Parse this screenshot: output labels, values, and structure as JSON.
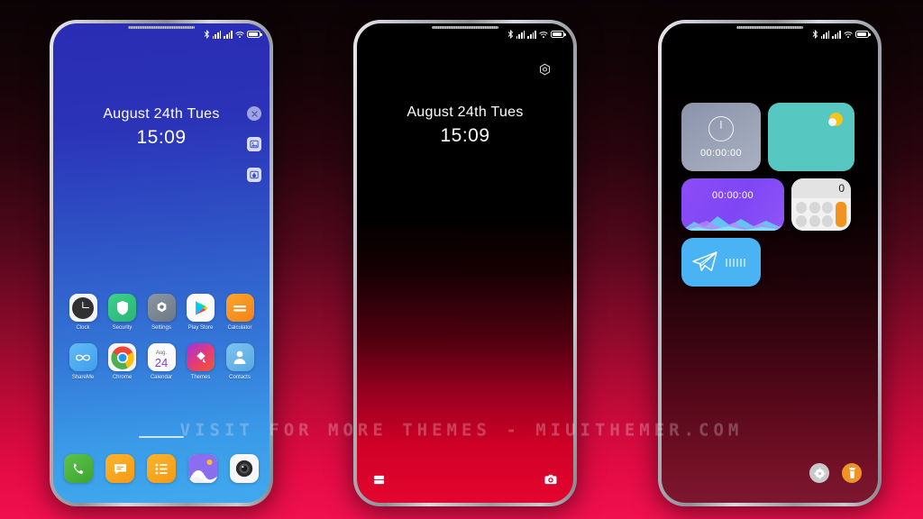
{
  "watermark": "VISIT FOR MORE THEMES - MIUITHEMER.COM",
  "statusbar": {
    "bluetooth_icon": "bluetooth-icon",
    "signal1_icon": "signal-bars-icon",
    "signal2_icon": "signal-bars-icon",
    "wifi_icon": "wifi-icon",
    "battery_icon": "battery-icon"
  },
  "phone1": {
    "name": "home-screen-blue",
    "lock": {
      "date": "August 24th Tues",
      "time": "15:09"
    },
    "side_buttons": [
      {
        "name": "close-button",
        "icon": "close-icon",
        "glyph": "✕"
      },
      {
        "name": "wallpaper-button",
        "icon": "image-icon",
        "glyph": "◰"
      },
      {
        "name": "theme-button",
        "icon": "droplet-icon",
        "glyph": "●"
      }
    ],
    "apps_row1": [
      {
        "label": "Clock",
        "icon": "clock-icon"
      },
      {
        "label": "Security",
        "icon": "shield-icon"
      },
      {
        "label": "Settings",
        "icon": "gear-icon"
      },
      {
        "label": "Play Store",
        "icon": "play-store-icon"
      },
      {
        "label": "Calculator",
        "icon": "calculator-icon"
      }
    ],
    "apps_row2": [
      {
        "label": "ShareMe",
        "icon": "shareme-icon"
      },
      {
        "label": "Chrome",
        "icon": "chrome-icon"
      },
      {
        "label": "Calendar",
        "icon": "calendar-icon",
        "month": "Aug.",
        "day": "24"
      },
      {
        "label": "Themes",
        "icon": "themes-icon"
      },
      {
        "label": "Contacts",
        "icon": "contacts-icon"
      }
    ],
    "dock": [
      {
        "label": "Phone",
        "icon": "phone-icon"
      },
      {
        "label": "Messages",
        "icon": "message-icon"
      },
      {
        "label": "Notes",
        "icon": "notes-icon"
      },
      {
        "label": "Gallery",
        "icon": "gallery-icon"
      },
      {
        "label": "Camera",
        "icon": "camera-icon"
      }
    ]
  },
  "phone2": {
    "name": "lock-screen-red",
    "lock": {
      "date": "August 24th Tues",
      "time": "15:09"
    },
    "settings_icon": "gear-hex-icon",
    "shortcuts": [
      {
        "name": "wallet-shortcut",
        "icon": "card-icon"
      },
      {
        "name": "camera-shortcut",
        "icon": "camera-icon"
      }
    ]
  },
  "phone3": {
    "name": "widgets-screen-dark",
    "widgets": [
      {
        "name": "clock-widget",
        "icon": "stopwatch-icon",
        "value": "00:00:00",
        "color": "#9aa2b6"
      },
      {
        "name": "weather-widget",
        "icon": "sun-cloud-icon",
        "color": "#57c7c2"
      },
      {
        "name": "recorder-widget",
        "icon": "waveform-icon",
        "value": "00:00:00",
        "color": "#8b4df7"
      },
      {
        "name": "calculator-widget",
        "icon": "calculator-icon",
        "value": "0",
        "color": "#f2f2f2"
      },
      {
        "name": "telegram-widget",
        "icon": "telegram-icon",
        "color": "#4ab3f4"
      }
    ],
    "buttons": [
      {
        "name": "settings-button",
        "icon": "gear-icon"
      },
      {
        "name": "flashlight-button",
        "icon": "flashlight-icon"
      }
    ]
  }
}
